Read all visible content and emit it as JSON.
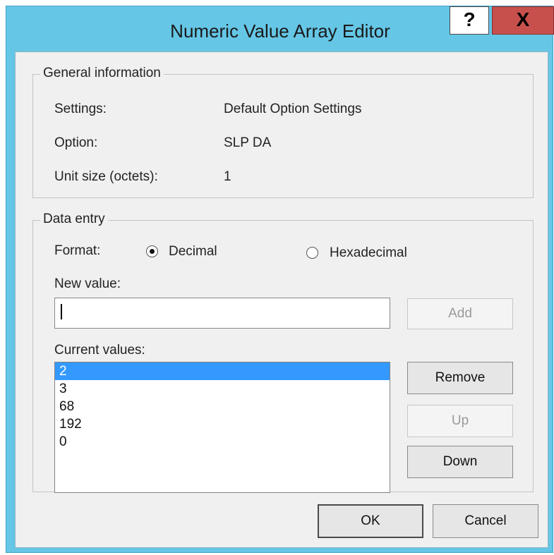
{
  "window": {
    "title": "Numeric Value Array Editor",
    "help_glyph": "?",
    "close_glyph": "X"
  },
  "general": {
    "legend": "General information",
    "settings_label": "Settings:",
    "settings_value": "Default Option Settings",
    "option_label": "Option:",
    "option_value": "SLP DA",
    "unit_label": "Unit size (octets):",
    "unit_value": "1"
  },
  "data_entry": {
    "legend": "Data entry",
    "format_label": "Format:",
    "format_options": [
      "Decimal",
      "Hexadecimal"
    ],
    "format_selected": "Decimal",
    "new_value_label": "New value:",
    "new_value": "",
    "add_label": "Add",
    "current_values_label": "Current values:",
    "current_values": [
      "2",
      "3",
      "68",
      "192",
      "0"
    ],
    "selected_value": "2",
    "remove_label": "Remove",
    "up_label": "Up",
    "down_label": "Down"
  },
  "footer": {
    "ok_label": "OK",
    "cancel_label": "Cancel"
  }
}
